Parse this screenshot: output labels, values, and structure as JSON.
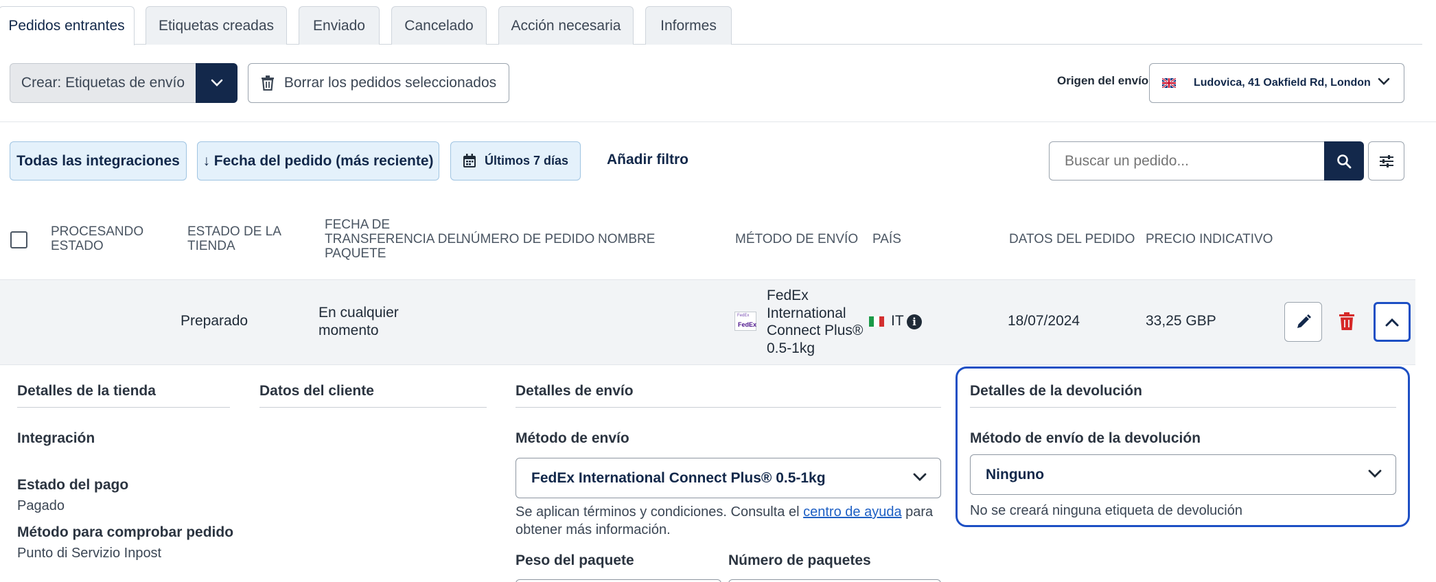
{
  "tabs": [
    "Pedidos entrantes",
    "Etiquetas creadas",
    "Enviado",
    "Cancelado",
    "Acción necesaria",
    "Informes"
  ],
  "toolbar": {
    "create_label": "Crear: Etiquetas de envío",
    "delete_label": "Borrar los pedidos seleccionados",
    "origin_label": "Origen del envío",
    "origin_value": "Ludovica, 41 Oakfield Rd, London"
  },
  "filters": {
    "integrations": "Todas las integraciones",
    "sort": "↓ Fecha del pedido (más reciente)",
    "date_range": "Últimos 7 días",
    "add_filter": "Añadir filtro",
    "search_placeholder": "Buscar un pedido..."
  },
  "table": {
    "headers": {
      "processing_1": "PROCESANDO",
      "processing_2": "ESTADO",
      "store_1": "ESTADO DE LA",
      "store_2": "TIENDA",
      "transfer_1": "FECHA DE",
      "transfer_2": "TRANSFERENCIA DEL",
      "transfer_3": "PAQUETE",
      "order_number": "NÚMERO DE PEDIDO",
      "name": "NOMBRE",
      "shipping_method": "MÉTODO DE ENVÍO",
      "country": "PAÍS",
      "order_data": "DATOS DEL PEDIDO",
      "price": "PRECIO INDICATIVO"
    },
    "row": {
      "store_status": "Preparado",
      "transfer_1": "En cualquier",
      "transfer_2": "momento",
      "carrier_logo_1": "FedEx",
      "carrier_logo_2": "FedEx",
      "method_1": "FedEx",
      "method_2": "International",
      "method_3": "Connect Plus®",
      "method_4": "0.5-1kg",
      "country": "IT",
      "date": "18/07/2024",
      "price": "33,25 GBP"
    }
  },
  "details": {
    "store": {
      "title": "Detalles de la tienda",
      "integration_label": "Integración",
      "payment_label": "Estado del pago",
      "payment_value": "Pagado",
      "verify_label": "Método para comprobar pedido",
      "verify_value": "Punto di Servizio Inpost"
    },
    "customer": {
      "title": "Datos del cliente"
    },
    "shipping": {
      "title": "Detalles de envío",
      "method_label": "Método de envío",
      "method_value": "FedEx International Connect Plus® 0.5-1kg",
      "terms_1": "Se aplican términos y condiciones. Consulta el",
      "terms_link": "centro de ayuda",
      "terms_2": "para",
      "terms_3": "obtener más información.",
      "weight_label": "Peso del paquete",
      "packages_label": "Número de paquetes"
    },
    "returns": {
      "title": "Detalles de la devolución",
      "method_label": "Método de envío de la devolución",
      "method_value": "Ninguno",
      "note": "No se creará ninguna etiqueta de devolución"
    }
  },
  "colors": {
    "navy": "#13284b",
    "accent_blue": "#1d4fc4",
    "delete_red": "#d62828"
  }
}
